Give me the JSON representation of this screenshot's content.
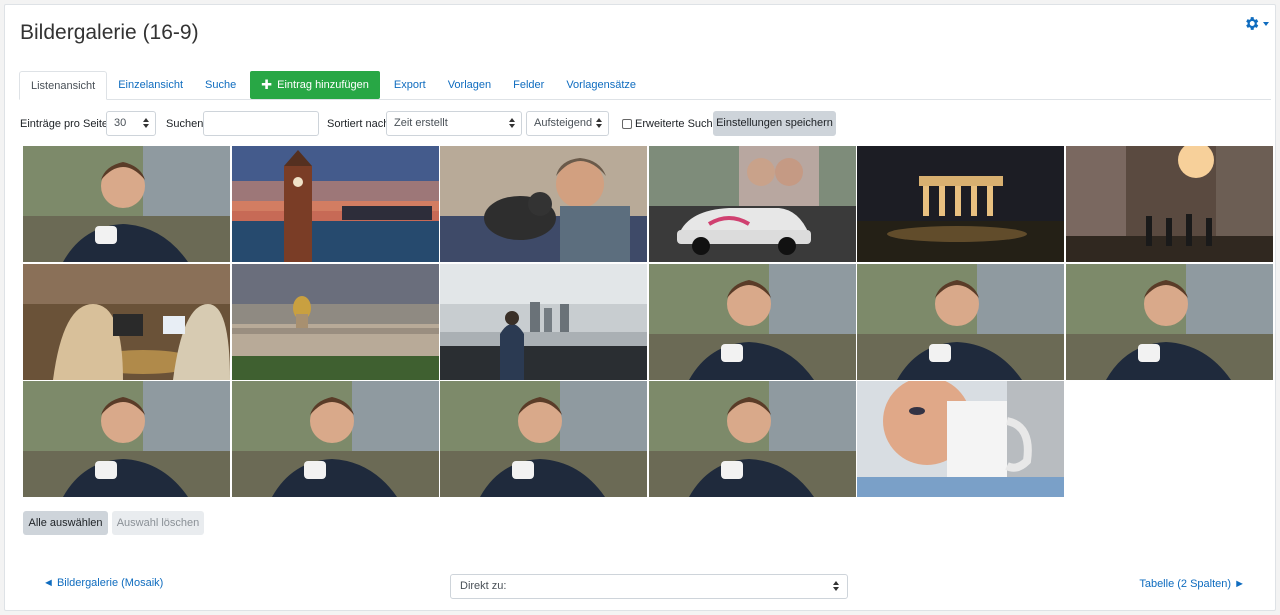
{
  "page": {
    "title": "Bildergalerie (16-9)",
    "settings_icon": "gear-icon"
  },
  "tabs": [
    {
      "label": "Listenansicht",
      "active": true
    },
    {
      "label": "Einzelansicht"
    },
    {
      "label": "Suche"
    },
    {
      "label": "Eintrag hinzufügen",
      "icon": "plus-icon"
    },
    {
      "label": "Export"
    },
    {
      "label": "Vorlagen"
    },
    {
      "label": "Felder"
    },
    {
      "label": "Vorlagensätze"
    }
  ],
  "controls": {
    "per_page_label": "Einträge pro Seite",
    "per_page_value": "30",
    "search_label": "Suchen",
    "search_value": "",
    "sort_label": "Sortiert nach",
    "sort_value": "Zeit erstellt",
    "order_value": "Aufsteigend",
    "advanced_search_label": "Erweiterte Suche",
    "advanced_search_checked": false,
    "save_settings_label": "Einstellungen speichern"
  },
  "gallery": {
    "images": [
      "portrait-man-coffee",
      "harbor-clock-tower-dusk",
      "man-with-cat",
      "berlin-wall-mural-trabant",
      "brandenburg-gate-night",
      "city-street-crowd-sunset",
      "cafe-people-laptops",
      "paris-skyline-dome",
      "person-viewing-city-skyline",
      "portrait-man-coffee",
      "portrait-man-coffee",
      "portrait-man-coffee",
      "portrait-man-coffee",
      "portrait-man-coffee",
      "portrait-man-coffee",
      "portrait-man-coffee",
      "man-drinking-from-mug"
    ]
  },
  "actions": {
    "select_all_label": "Alle auswählen",
    "clear_selection_label": "Auswahl löschen"
  },
  "footer": {
    "prev_label": "◄ Bildergalerie (Mosaik)",
    "jump_placeholder": "Direkt zu:",
    "next_label": "Tabelle (2 Spalten) ►"
  },
  "colors": {
    "accent": "#0f6cbf",
    "add_button": "#28a745"
  }
}
